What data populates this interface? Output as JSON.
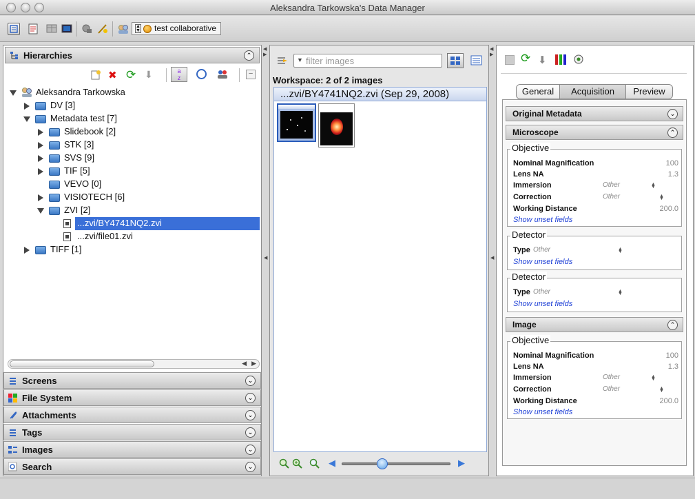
{
  "window": {
    "title": "Aleksandra Tarkowska's Data Manager"
  },
  "toolbar": {
    "group_label": "test collaborative"
  },
  "hierarchies": {
    "title": "Hierarchies",
    "root": "Aleksandra Tarkowska",
    "items": [
      {
        "label": "DV [3]"
      },
      {
        "label": "Metadata test [7]"
      },
      {
        "label": "Slidebook [2]"
      },
      {
        "label": "STK [3]"
      },
      {
        "label": "SVS [9]"
      },
      {
        "label": "TIF [5]"
      },
      {
        "label": "VEVO [0]"
      },
      {
        "label": "VISIOTECH [6]"
      },
      {
        "label": "ZVI [2]"
      },
      {
        "label": "...zvi/BY4741NQ2.zvi"
      },
      {
        "label": "...zvi/file01.zvi"
      },
      {
        "label": "TIFF [1]"
      }
    ]
  },
  "accordion": {
    "screens": "Screens",
    "filesystem": "File System",
    "attachments": "Attachments",
    "tags": "Tags",
    "images": "Images",
    "search": "Search"
  },
  "center": {
    "filter_placeholder": "filter  images",
    "workspace": "Workspace: 2 of 2 images",
    "header": "...zvi/BY4741NQ2.zvi (Sep 29, 2008)",
    "zoom_fraction": 0.37
  },
  "right": {
    "tabs": {
      "general": "General",
      "acquisition": "Acquisition",
      "preview": "Preview"
    },
    "original_metadata": "Original Metadata",
    "microscope": "Microscope",
    "image": "Image",
    "objective": "Objective",
    "detector": "Detector",
    "fields": {
      "nominal_mag": "Nominal Magnification",
      "lens_na": "Lens NA",
      "immersion": "Immersion",
      "correction": "Correction",
      "working_distance": "Working Distance",
      "type": "Type"
    },
    "values": {
      "nominal_mag": "100",
      "lens_na": "1.3",
      "other": "Other",
      "working_distance": "200.0"
    },
    "show_unset": "Show unset fields"
  },
  "colors": {
    "selection": "#3a6fd8",
    "link": "#1d3fd6"
  }
}
